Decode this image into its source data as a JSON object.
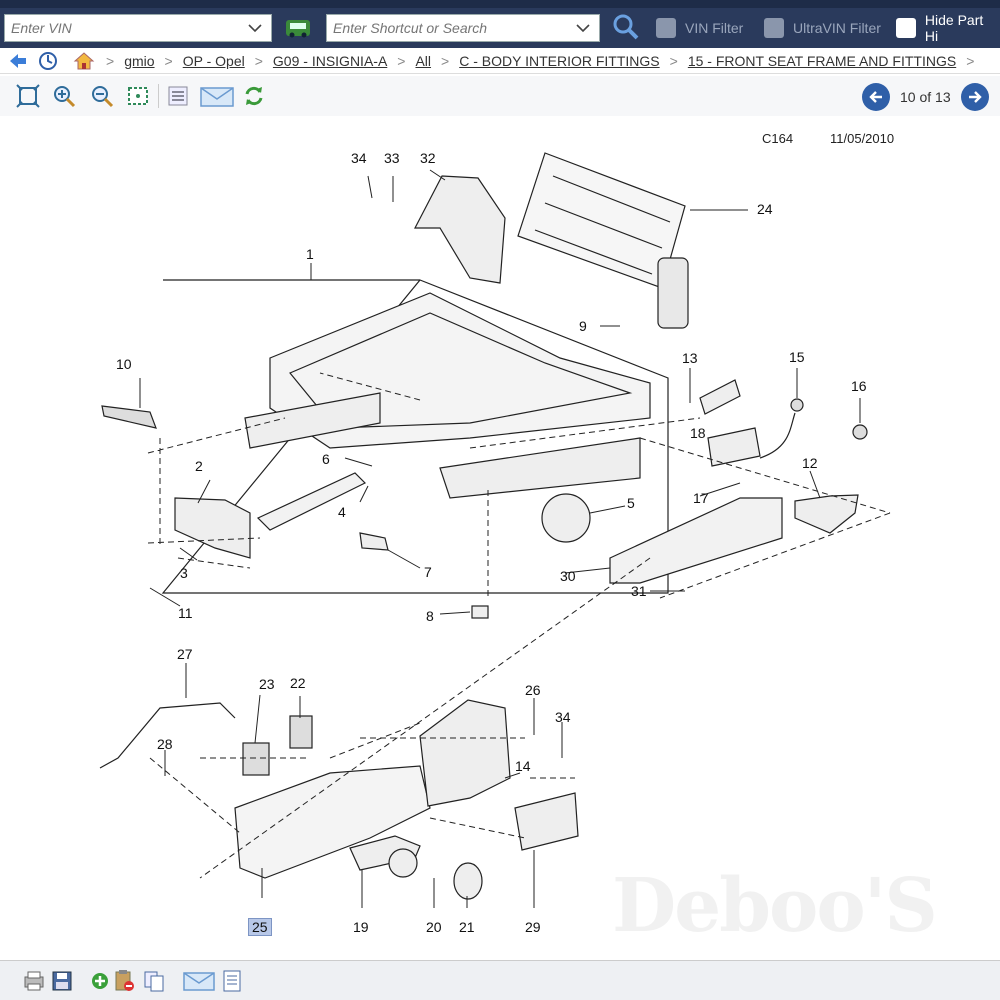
{
  "topbar": {
    "vin_placeholder": "Enter VIN",
    "search_placeholder": "Enter Shortcut or Search",
    "vin_filter_label": "VIN Filter",
    "ultravin_filter_label": "UltraVIN Filter",
    "hide_part_label": "Hide Part Hi"
  },
  "breadcrumb": [
    "gmio",
    "OP - Opel",
    "G09 - INSIGNIA-A",
    "All",
    "C - BODY INTERIOR FITTINGS",
    "15 - FRONT SEAT FRAME AND FITTINGS"
  ],
  "pager": {
    "text": "10 of 13"
  },
  "diagram": {
    "code": "C164",
    "date": "11/05/2010",
    "callouts": [
      "34",
      "33",
      "32",
      "24",
      "1",
      "9",
      "10",
      "13",
      "15",
      "16",
      "18",
      "2",
      "6",
      "4",
      "17",
      "12",
      "5",
      "3",
      "7",
      "30",
      "31",
      "11",
      "8",
      "27",
      "23",
      "22",
      "26",
      "34",
      "28",
      "14",
      "25",
      "19",
      "20",
      "21",
      "29"
    ],
    "highlighted": "25",
    "watermark": "Deboo'S"
  },
  "colors": {
    "topbar": "#2a3a5c",
    "nav_button": "#2f5fa8",
    "highlight": "#b8c8e8"
  }
}
